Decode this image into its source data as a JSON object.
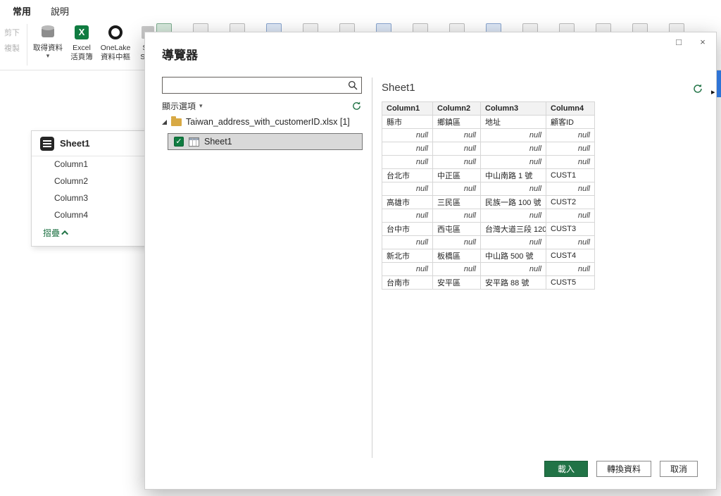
{
  "colors": {
    "accent": "#217346",
    "selection": "#d9d9d9",
    "edge_scrollbar": "#2e74d6"
  },
  "icons": {
    "dropdown": "▾",
    "check": "✓",
    "maximize": "□",
    "close": "×",
    "expand_right": "▸"
  },
  "ribbon": {
    "tabs": [
      {
        "label": "常用"
      },
      {
        "label": "說明"
      }
    ],
    "clipboard": {
      "cut": "剪下",
      "copy": "複製"
    },
    "buttons": {
      "get_data": {
        "label": "取得資料"
      },
      "excel": {
        "line1": "Excel",
        "line2": "活頁簿"
      },
      "onelake": {
        "line1": "OneLake",
        "line2": "資料中樞"
      },
      "sql": {
        "line1": "SQ",
        "line2": "Serv"
      }
    }
  },
  "panel": {
    "title": "Sheet1",
    "items": [
      "Column1",
      "Column2",
      "Column3",
      "Column4"
    ],
    "collapse_label": "摺疊"
  },
  "dialog": {
    "title": "導覽器",
    "search": {
      "placeholder": "",
      "value": ""
    },
    "display_options_label": "顯示選項",
    "tree": {
      "root_label": "Taiwan_address_with_customerID.xlsx [1]",
      "sheet_label": "Sheet1",
      "sheet_checked": true
    },
    "preview": {
      "title": "Sheet1",
      "columns": [
        "Column1",
        "Column2",
        "Column3",
        "Column4"
      ],
      "rows": [
        [
          "縣市",
          "鄉鎮區",
          "地址",
          "顧客ID"
        ],
        [
          "null",
          "null",
          "null",
          "null"
        ],
        [
          "null",
          "null",
          "null",
          "null"
        ],
        [
          "null",
          "null",
          "null",
          "null"
        ],
        [
          "台北市",
          "中正區",
          "中山南路 1 號",
          "CUST1"
        ],
        [
          "null",
          "null",
          "null",
          "null"
        ],
        [
          "高雄市",
          "三民區",
          "民族一路 100 號",
          "CUST2"
        ],
        [
          "null",
          "null",
          "null",
          "null"
        ],
        [
          "台中市",
          "西屯區",
          "台灣大道三段 120",
          "CUST3"
        ],
        [
          "null",
          "null",
          "null",
          "null"
        ],
        [
          "新北市",
          "板橋區",
          "中山路 500 號",
          "CUST4"
        ],
        [
          "null",
          "null",
          "null",
          "null"
        ],
        [
          "台南市",
          "安平區",
          "安平路 88 號",
          "CUST5"
        ]
      ]
    },
    "buttons": {
      "load": "載入",
      "transform": "轉換資料",
      "cancel": "取消"
    }
  }
}
